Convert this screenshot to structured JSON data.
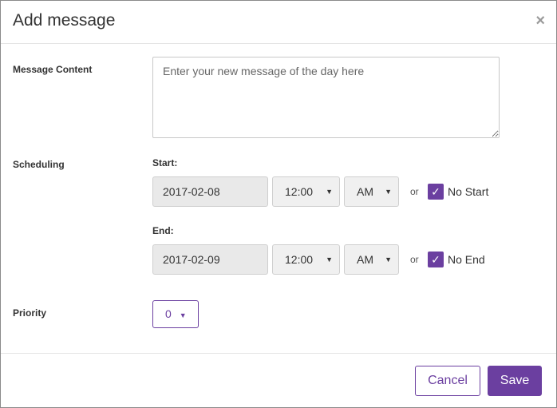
{
  "dialog": {
    "title": "Add message",
    "close_glyph": "×"
  },
  "form": {
    "message": {
      "label": "Message Content",
      "placeholder": "Enter your new message of the day here",
      "value": ""
    },
    "scheduling": {
      "label": "Scheduling",
      "start": {
        "label": "Start:",
        "date": "2017-02-08",
        "time": "12:00",
        "ampm": "AM",
        "or": "or",
        "checkbox_label": "No Start",
        "checked": true
      },
      "end": {
        "label": "End:",
        "date": "2017-02-09",
        "time": "12:00",
        "ampm": "AM",
        "or": "or",
        "checkbox_label": "No End",
        "checked": true
      }
    },
    "priority": {
      "label": "Priority",
      "value": "0"
    }
  },
  "footer": {
    "cancel_label": "Cancel",
    "save_label": "Save"
  },
  "icons": {
    "caret": "▼",
    "check": "✓"
  },
  "colors": {
    "accent": "#6b3fa0",
    "field_bg": "#e9e9e9"
  }
}
